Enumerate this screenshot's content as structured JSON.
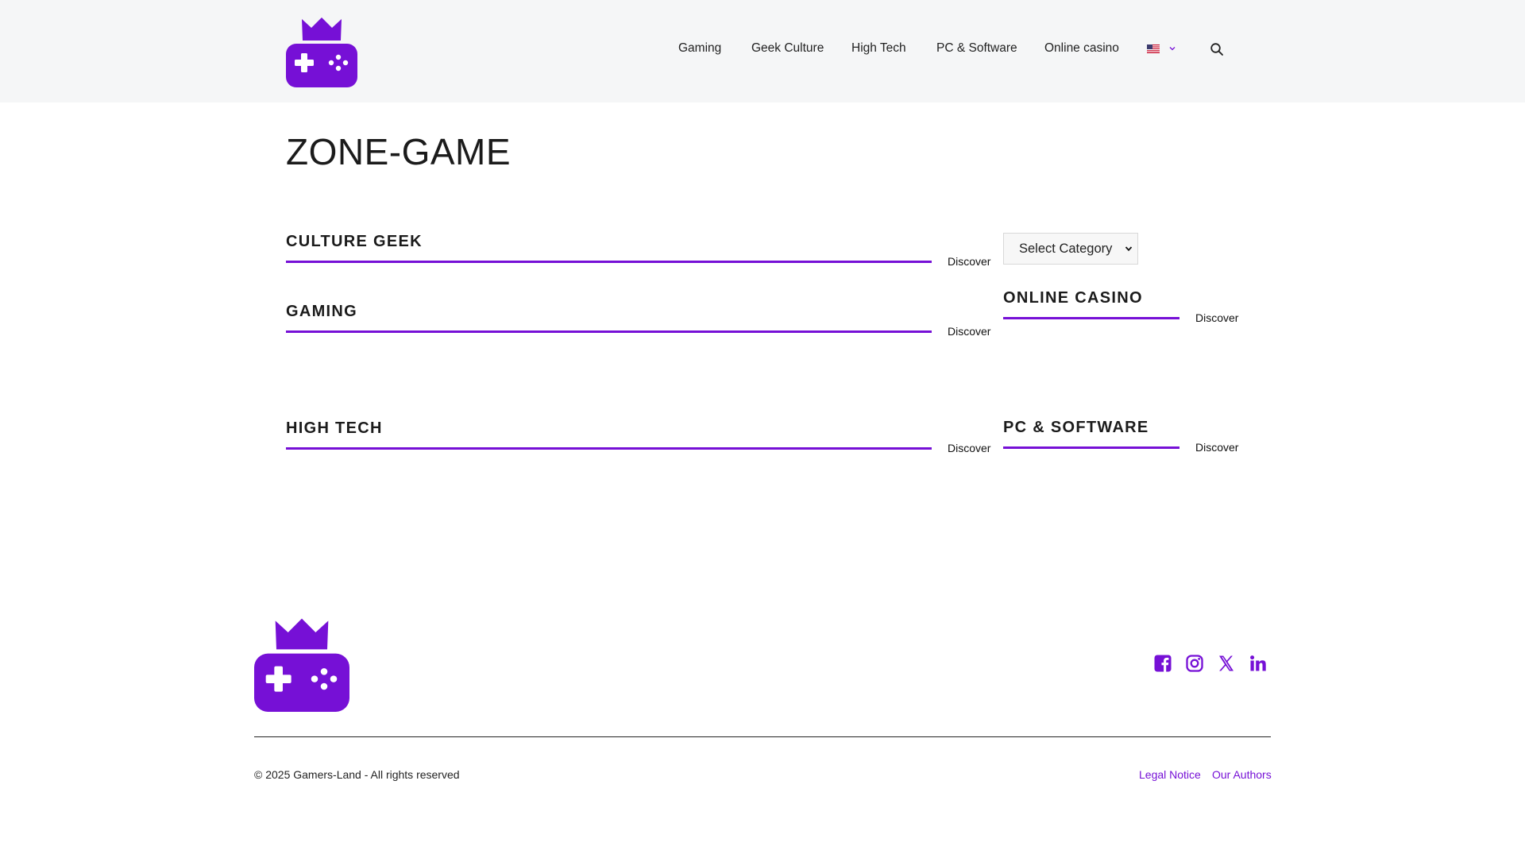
{
  "brand": {
    "accent": "#7610d6"
  },
  "header": {
    "logo_icon": "gamepad-crown-logo",
    "nav": [
      {
        "label": "Gaming"
      },
      {
        "label": "Geek Culture"
      },
      {
        "label": "High Tech"
      },
      {
        "label": "PC & Software"
      },
      {
        "label": "Online casino"
      }
    ],
    "language": {
      "icon": "us-flag-icon",
      "dropdown_icon": "chevron-down-icon"
    },
    "search_icon": "search-icon"
  },
  "main": {
    "title": "ZONE-GAME",
    "categories": [
      {
        "title": "CULTURE GEEK",
        "link": "Discover"
      },
      {
        "title": "GAMING",
        "link": "Discover"
      },
      {
        "title": "HIGH TECH",
        "link": "Discover"
      }
    ]
  },
  "sidebar": {
    "select": {
      "selected": "Select Category"
    },
    "categories": [
      {
        "title": "ONLINE CASINO",
        "link": "Discover"
      },
      {
        "title": "PC & SOFTWARE",
        "link": "Discover"
      }
    ]
  },
  "footer": {
    "logo_icon": "gamepad-crown-logo",
    "social": [
      {
        "icon": "facebook-icon"
      },
      {
        "icon": "instagram-icon"
      },
      {
        "icon": "x-icon"
      },
      {
        "icon": "linkedin-icon"
      }
    ],
    "copyright": "© 2025 Gamers-Land - All rights reserved",
    "links": [
      {
        "label": "Legal Notice"
      },
      {
        "label": "Our Authors"
      }
    ]
  }
}
